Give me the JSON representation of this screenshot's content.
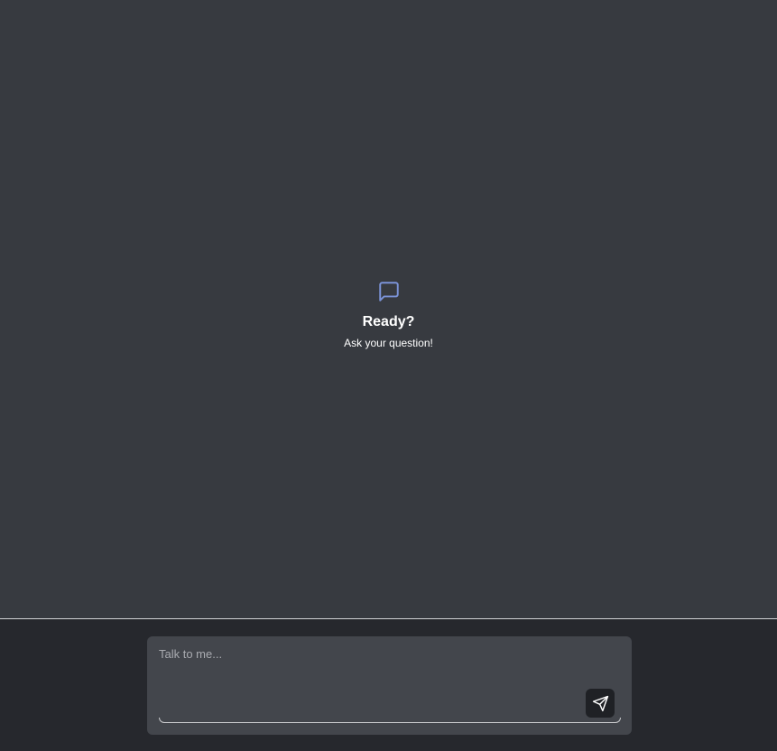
{
  "empty_state": {
    "icon": "message-square-icon",
    "title": "Ready?",
    "subtitle": "Ask your question!"
  },
  "composer": {
    "placeholder": "Talk to me...",
    "value": "",
    "send_icon": "send-icon"
  },
  "colors": {
    "background": "#373a40",
    "footer": "#26282d",
    "input": "#43464c",
    "accent_icon": "#7b93d8",
    "send_button": "#1f2125"
  }
}
